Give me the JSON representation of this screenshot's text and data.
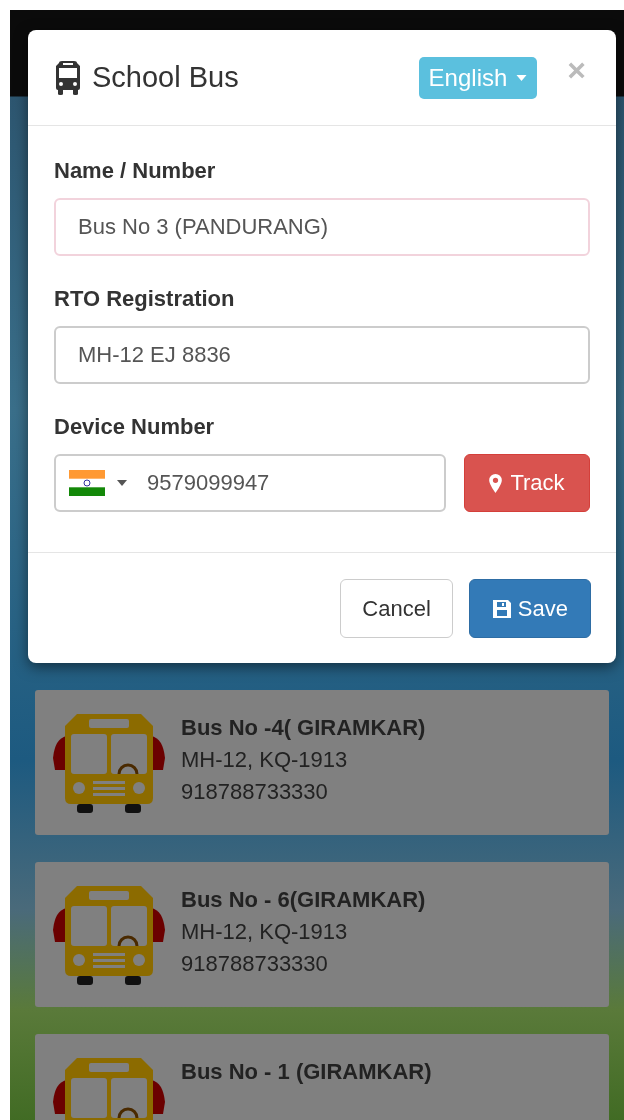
{
  "modal": {
    "title": "School Bus",
    "language": "English",
    "close": "×",
    "fields": [
      {
        "label": "Name / Number",
        "value": "Bus No 3 (PANDURANG)",
        "focused": true
      },
      {
        "label": "RTO Registration",
        "value": "MH-12 EJ 8836",
        "focused": false
      }
    ],
    "device": {
      "label": "Device Number",
      "value": "9579099947",
      "track": "Track"
    },
    "buttons": [
      {
        "label": "Cancel",
        "kind": "default"
      },
      {
        "label": "Save",
        "kind": "primary"
      }
    ]
  },
  "buses": [
    {
      "name": "Bus No -4( GIRAMKAR)",
      "registration": "MH-12, KQ-1913",
      "phone": "918788733330"
    },
    {
      "name": "Bus No - 6(GIRAMKAR)",
      "registration": "MH-12, KQ-1913",
      "phone": "918788733330"
    },
    {
      "name": "Bus No - 1 (GIRAMKAR)"
    }
  ]
}
